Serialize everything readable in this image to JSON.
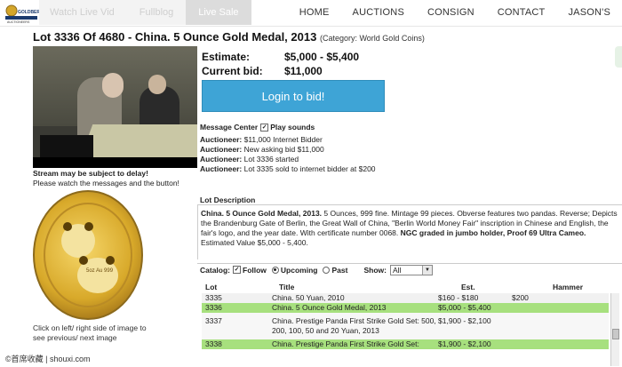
{
  "header": {
    "tabs": [
      {
        "label": "Watch Live Vid"
      },
      {
        "label": "Fullblog"
      },
      {
        "label": "Live Sale"
      }
    ],
    "nav": [
      {
        "label": "HOME"
      },
      {
        "label": "AUCTIONS"
      },
      {
        "label": "CONSIGN"
      },
      {
        "label": "CONTACT"
      },
      {
        "label": "JASON'S"
      }
    ]
  },
  "lot": {
    "title": "Lot 3336 Of 4680 - China. 5 Ounce Gold Medal, 2013",
    "category": "(Category: World Gold Coins)",
    "estimate_label": "Estimate:",
    "estimate_value": "$5,000 - $5,400",
    "current_bid_label": "Current bid:",
    "current_bid_value": "$11,000",
    "login_button": "Login to bid!"
  },
  "stream": {
    "delay_line1": "Stream may be subject to delay!",
    "delay_line2": "Please watch the messages and the button!"
  },
  "coin": {
    "caption": "Click on left/ right side of image to see previous/ next image",
    "inscription": "5oz Au 999"
  },
  "messages": {
    "title": "Message Center",
    "play_sounds": "Play sounds",
    "items": [
      {
        "who": "Auctioneer:",
        "text": "$11,000 Internet Bidder"
      },
      {
        "who": "Auctioneer:",
        "text": "New asking bid $11,000"
      },
      {
        "who": "Auctioneer:",
        "text": "Lot 3336 started"
      },
      {
        "who": "Auctioneer:",
        "text": "Lot 3335 sold to internet bidder at $200"
      }
    ]
  },
  "description": {
    "title": "Lot Description",
    "bold_intro": "China. 5 Ounce Gold Medal, 2013.",
    "text": " 5 Ounces, 999 fine. Mintage 99 pieces. Obverse features two pandas. Reverse; Depicts the Brandenburg Gate of Berlin, the Great Wall of China, \"Berlin World Money Fair\" inscription in Chinese and English, the fair's logo, and the year date. With certificate number 0068. ",
    "bold_grade": "NGC graded in jumbo holder, Proof 69 Ultra Cameo.",
    "estimated": "Estimated Value $5,000 - 5,400."
  },
  "catalog": {
    "label": "Catalog:",
    "follow": "Follow",
    "upcoming": "Upcoming",
    "past": "Past",
    "show_label": "Show:",
    "show_value": "All",
    "columns": [
      "Lot",
      "Title",
      "Est.",
      "Hammer"
    ],
    "rows": [
      {
        "lot": "3335",
        "title": "China. 50 Yuan, 2010",
        "est": "$160 - $180",
        "hammer": "$200"
      },
      {
        "lot": "3336",
        "title": "China. 5 Ounce Gold Medal, 2013",
        "est": "$5,000 - $5,400",
        "hammer": ""
      },
      {
        "lot": "3337",
        "title": "China. Prestige Panda First Strike Gold Set: 500, 200, 100, 50 and 20 Yuan, 2013",
        "est": "$1,900 - $2,100",
        "hammer": ""
      },
      {
        "lot": "3338",
        "title": "China. Prestige Panda First Strike Gold Set:",
        "est": "$1,900 - $2,100",
        "hammer": ""
      }
    ]
  },
  "watermark": "©首席收藏 | shouxi.com"
}
